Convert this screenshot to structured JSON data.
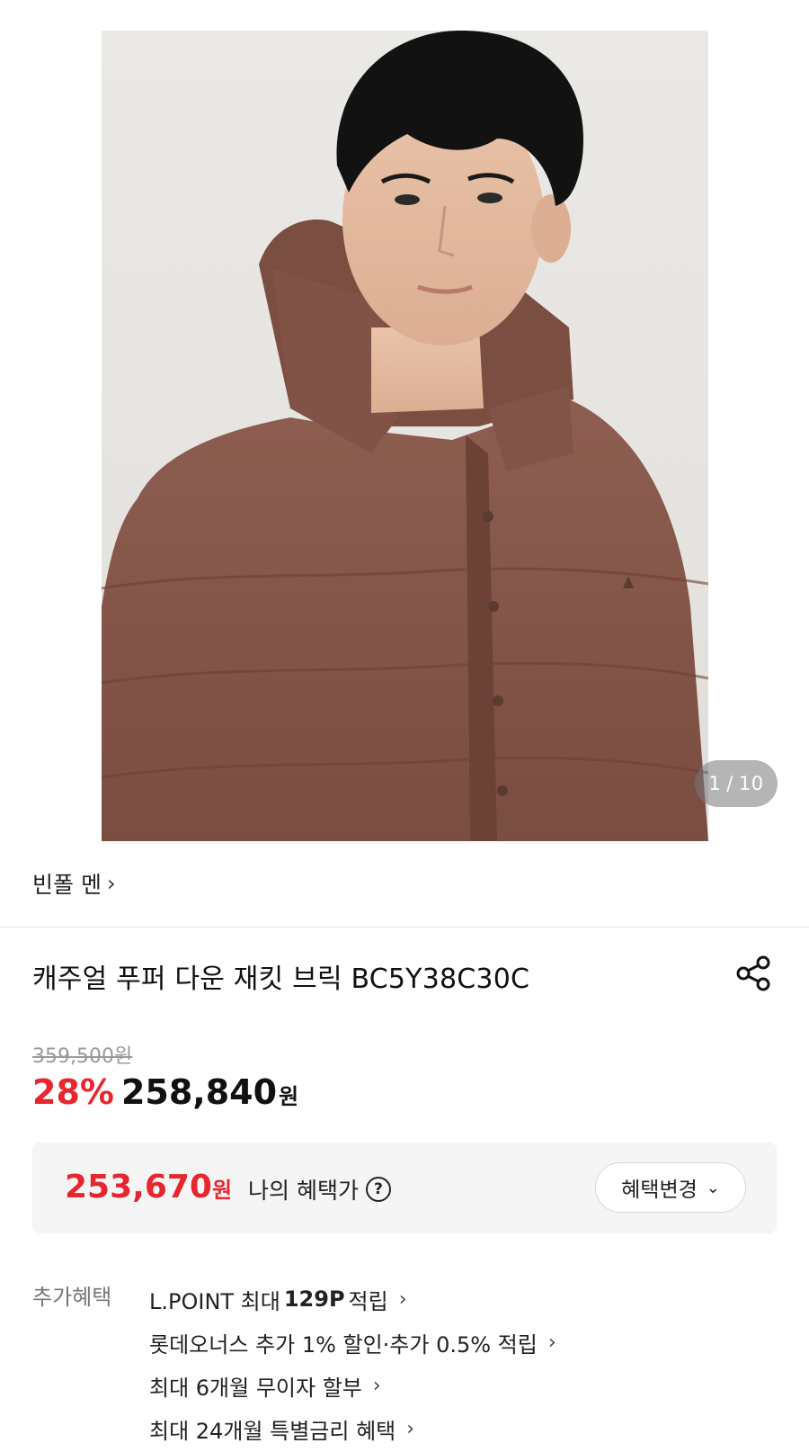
{
  "gallery": {
    "current": "1",
    "separator": "/",
    "total": "10"
  },
  "brand": {
    "name": "빈폴 멘",
    "chevron": "›"
  },
  "product": {
    "title": "캐주얼 푸퍼 다운 재킷 브릭 BC5Y38C30C"
  },
  "price": {
    "original": "359,500원",
    "discount_rate": "28%",
    "sale_price": "258,840",
    "currency": "원"
  },
  "my_benefit": {
    "price": "253,670",
    "currency": "원",
    "label": "나의 혜택가",
    "help_glyph": "?",
    "change_button": "혜택변경",
    "change_button_icon": "⌄"
  },
  "extra_benefits": {
    "label": "추가혜택",
    "items": [
      {
        "prefix": "L.POINT 최대 ",
        "strong": "129P",
        "suffix": " 적립"
      },
      {
        "prefix": "롯데오너스 추가 1% 할인·추가 0.5% 적립",
        "strong": "",
        "suffix": ""
      },
      {
        "prefix": "최대 6개월 무이자 할부",
        "strong": "",
        "suffix": ""
      },
      {
        "prefix": "최대 24개월 특별금리 혜택",
        "strong": "",
        "suffix": ""
      }
    ],
    "arrow": "›"
  },
  "colors": {
    "accent_red": "#e8262f",
    "jacket": "#8a5a4c",
    "benefit_bg": "#f5f5f5"
  }
}
